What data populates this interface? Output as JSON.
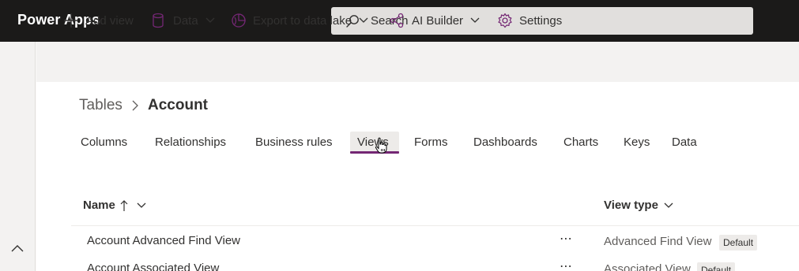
{
  "app": {
    "title": "Power Apps"
  },
  "search": {
    "placeholder": "Search"
  },
  "commandbar": {
    "add_view": "Add view",
    "data": "Data",
    "export": "Export to data lake",
    "ai_builder": "AI Builder",
    "settings": "Settings"
  },
  "breadcrumb": {
    "parent": "Tables",
    "current": "Account"
  },
  "tabs": [
    "Columns",
    "Relationships",
    "Business rules",
    "Views",
    "Forms",
    "Dashboards",
    "Charts",
    "Keys",
    "Data"
  ],
  "active_tab": "Views",
  "table": {
    "columns": {
      "name": "Name",
      "view_type": "View type"
    },
    "sort": {
      "column": "Name",
      "direction": "ascending"
    },
    "rows": [
      {
        "name": "Account Advanced Find View",
        "view_type": "Advanced Find View",
        "badge": "Default"
      },
      {
        "name": "Account Associated View",
        "view_type": "Associated View",
        "badge": "Default"
      }
    ]
  },
  "colors": {
    "topbar": "#1b1a19",
    "accent": "#742774",
    "commandbar": "#f3f2f1"
  }
}
